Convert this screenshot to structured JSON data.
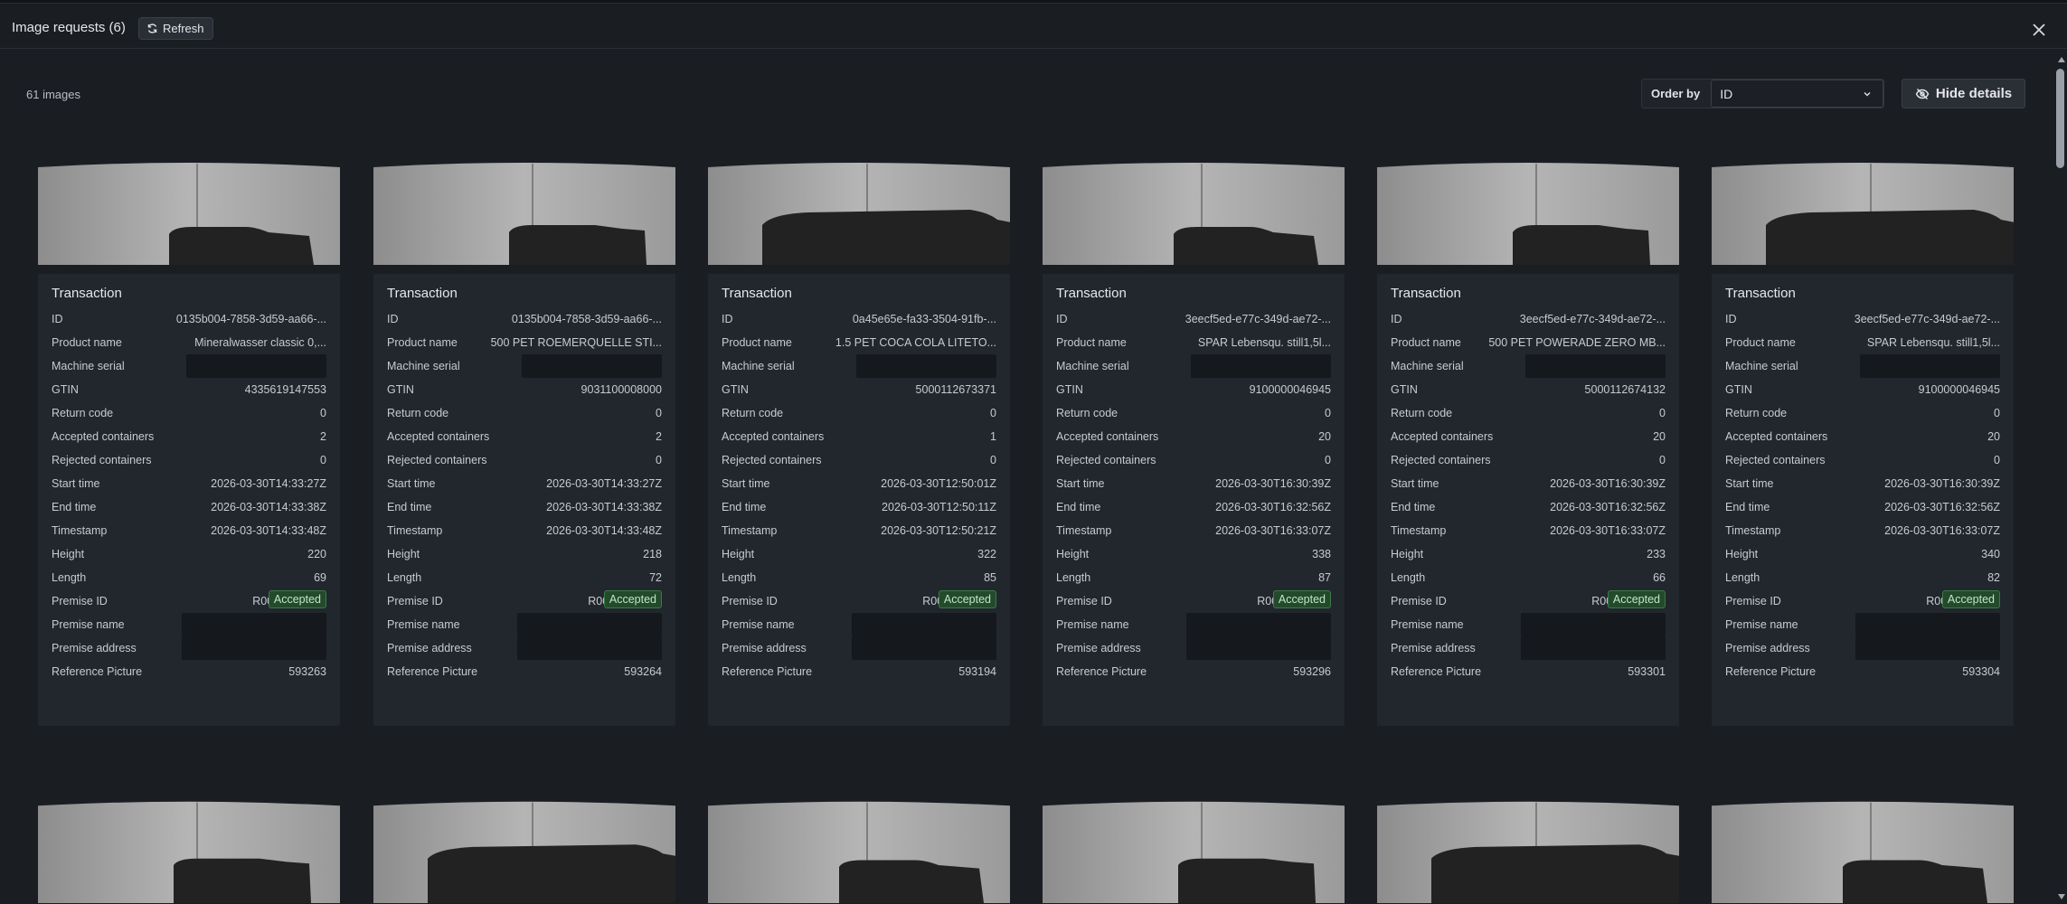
{
  "header": {
    "title": "Image requests (6)",
    "refresh_label": "Refresh"
  },
  "toolbar": {
    "count": "61 images",
    "order_by_label": "Order by",
    "order_by_value": "ID",
    "hide_details_label": "Hide details"
  },
  "card_title": "Transaction",
  "field_labels": {
    "id": "ID",
    "product_name": "Product name",
    "machine_serial": "Machine serial",
    "gtin": "GTIN",
    "return_code": "Return code",
    "accepted": "Accepted containers",
    "rejected": "Rejected containers",
    "start_time": "Start time",
    "end_time": "End time",
    "timestamp": "Timestamp",
    "height": "Height",
    "length": "Length",
    "premise_id": "Premise ID",
    "premise_name": "Premise name",
    "premise_address": "Premise address",
    "reference_picture": "Reference Picture"
  },
  "cards": [
    {
      "id": "0135b004-7858-3d59-aa66-...",
      "product_name": "Mineralwasser classic 0,...",
      "gtin": "4335619147553",
      "return_code": "0",
      "accepted": "2",
      "rejected": "0",
      "start_time": "2026-03-30T14:33:27Z",
      "end_time": "2026-03-30T14:33:38Z",
      "timestamp": "2026-03-30T14:33:48Z",
      "height": "220",
      "length": "69",
      "premise_id": "R001136-0002",
      "reference_picture": "593263",
      "status": "Accepted"
    },
    {
      "id": "0135b004-7858-3d59-aa66-...",
      "product_name": "500 PET ROEMERQUELLE STI...",
      "gtin": "9031100008000",
      "return_code": "0",
      "accepted": "2",
      "rejected": "0",
      "start_time": "2026-03-30T14:33:27Z",
      "end_time": "2026-03-30T14:33:38Z",
      "timestamp": "2026-03-30T14:33:48Z",
      "height": "218",
      "length": "72",
      "premise_id": "R001136-0002",
      "reference_picture": "593264",
      "status": "Accepted"
    },
    {
      "id": "0a45e65e-fa33-3504-91fb-...",
      "product_name": "1.5 PET COCA COLA LITETO...",
      "gtin": "5000112673371",
      "return_code": "0",
      "accepted": "1",
      "rejected": "0",
      "start_time": "2026-03-30T12:50:01Z",
      "end_time": "2026-03-30T12:50:11Z",
      "timestamp": "2026-03-30T12:50:21Z",
      "height": "322",
      "length": "85",
      "premise_id": "R001136-0002",
      "reference_picture": "593194",
      "status": "Accepted"
    },
    {
      "id": "3eecf5ed-e77c-349d-ae72-...",
      "product_name": "SPAR Lebensqu. still1,5l...",
      "gtin": "9100000046945",
      "return_code": "0",
      "accepted": "20",
      "rejected": "0",
      "start_time": "2026-03-30T16:30:39Z",
      "end_time": "2026-03-30T16:32:56Z",
      "timestamp": "2026-03-30T16:33:07Z",
      "height": "338",
      "length": "87",
      "premise_id": "R001136-0002",
      "reference_picture": "593296",
      "status": "Accepted"
    },
    {
      "id": "3eecf5ed-e77c-349d-ae72-...",
      "product_name": "500 PET POWERADE ZERO MB...",
      "gtin": "5000112674132",
      "return_code": "0",
      "accepted": "20",
      "rejected": "0",
      "start_time": "2026-03-30T16:30:39Z",
      "end_time": "2026-03-30T16:32:56Z",
      "timestamp": "2026-03-30T16:33:07Z",
      "height": "233",
      "length": "66",
      "premise_id": "R001136-0002",
      "reference_picture": "593301",
      "status": "Accepted"
    },
    {
      "id": "3eecf5ed-e77c-349d-ae72-...",
      "product_name": "SPAR Lebensqu. still1,5l...",
      "gtin": "9100000046945",
      "return_code": "0",
      "accepted": "20",
      "rejected": "0",
      "start_time": "2026-03-30T16:30:39Z",
      "end_time": "2026-03-30T16:32:56Z",
      "timestamp": "2026-03-30T16:33:07Z",
      "height": "340",
      "length": "82",
      "premise_id": "R001136-0002",
      "reference_picture": "593304",
      "status": "Accepted"
    }
  ]
}
